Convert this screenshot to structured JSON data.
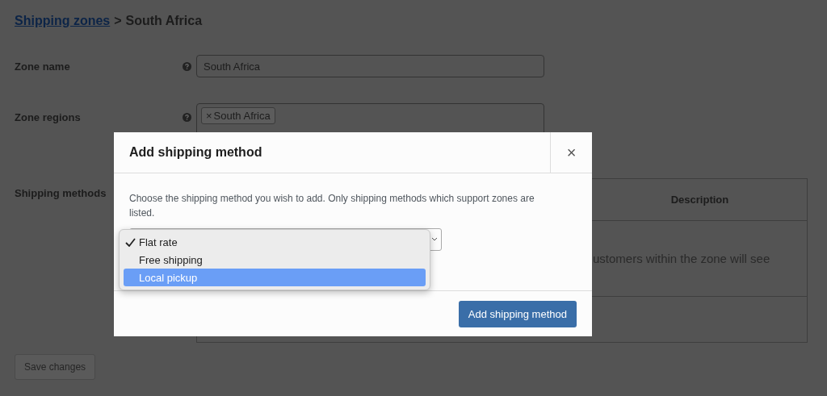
{
  "breadcrumb": {
    "link": "Shipping zones",
    "separator": ">",
    "current": "South Africa"
  },
  "fields": [
    {
      "label": "Zone name",
      "kind": "text",
      "value": "South Africa"
    },
    {
      "label": "Zone regions",
      "kind": "tags",
      "tags": [
        {
          "remove": "×",
          "label": "South Africa"
        }
      ]
    }
  ],
  "shipping_methods": {
    "label": "Shipping methods",
    "columns": [
      "Description"
    ],
    "rows": [
      {
        "description": "ustomers within the zone will see"
      }
    ]
  },
  "save_button": {
    "label": "Save changes",
    "disabled": true
  },
  "modal": {
    "title": "Add shipping method",
    "close": "×",
    "description": "Choose the shipping method you wish to add. Only shipping methods which support zones are listed.",
    "options": [
      {
        "label": "Flat rate",
        "checked": true,
        "selected": false
      },
      {
        "label": "Free shipping",
        "checked": false,
        "selected": false
      },
      {
        "label": "Local pickup",
        "checked": false,
        "selected": true
      }
    ],
    "button": "Add shipping method"
  }
}
